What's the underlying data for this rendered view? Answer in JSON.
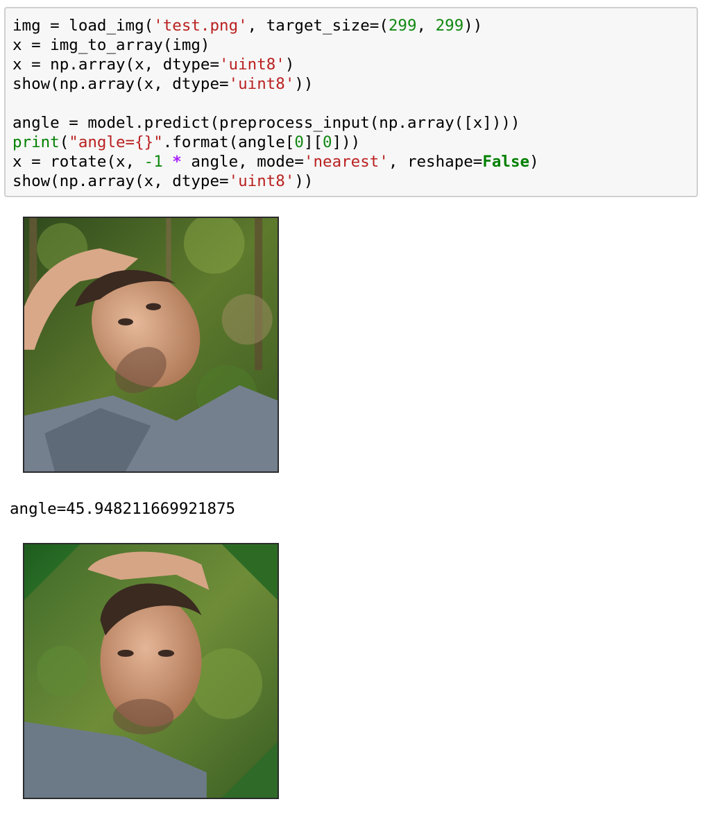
{
  "code_cell": {
    "lines": [
      [
        {
          "t": "img = load_img(",
          "c": ""
        },
        {
          "t": "'test.png'",
          "c": "str"
        },
        {
          "t": ", target_size=(",
          "c": ""
        },
        {
          "t": "299",
          "c": "num"
        },
        {
          "t": ", ",
          "c": ""
        },
        {
          "t": "299",
          "c": "num"
        },
        {
          "t": "))",
          "c": ""
        }
      ],
      [
        {
          "t": "x = img_to_array(img)",
          "c": ""
        }
      ],
      [
        {
          "t": "x = np.array(x, dtype=",
          "c": ""
        },
        {
          "t": "'uint8'",
          "c": "str"
        },
        {
          "t": ")",
          "c": ""
        }
      ],
      [
        {
          "t": "show(np.array(x, dtype=",
          "c": ""
        },
        {
          "t": "'uint8'",
          "c": "str"
        },
        {
          "t": "))",
          "c": ""
        }
      ],
      [],
      [
        {
          "t": "angle = model.predict(preprocess_input(np.array([x])))",
          "c": ""
        }
      ],
      [
        {
          "t": "print",
          "c": "builtin"
        },
        {
          "t": "(",
          "c": ""
        },
        {
          "t": "\"angle={}\"",
          "c": "str"
        },
        {
          "t": ".format(angle[",
          "c": ""
        },
        {
          "t": "0",
          "c": "num"
        },
        {
          "t": "][",
          "c": ""
        },
        {
          "t": "0",
          "c": "num"
        },
        {
          "t": "]))",
          "c": ""
        }
      ],
      [
        {
          "t": "x = rotate(x, ",
          "c": ""
        },
        {
          "t": "-1",
          "c": "num"
        },
        {
          "t": " ",
          "c": ""
        },
        {
          "t": "*",
          "c": "op"
        },
        {
          "t": " angle, mode=",
          "c": ""
        },
        {
          "t": "'nearest'",
          "c": "str"
        },
        {
          "t": ", reshape=",
          "c": ""
        },
        {
          "t": "False",
          "c": "kw"
        },
        {
          "t": ")",
          "c": ""
        }
      ],
      [
        {
          "t": "show(np.array(x, dtype=",
          "c": ""
        },
        {
          "t": "'uint8'",
          "c": "str"
        },
        {
          "t": "))",
          "c": ""
        }
      ]
    ]
  },
  "outputs": {
    "image_original": {
      "subject": "man-tilted-head-forest-photo"
    },
    "stdout_text": "angle=45.948211669921875",
    "image_rotated": {
      "subject": "man-upright-head-rotated-photo",
      "rotation_deg": -45.948211669921875
    }
  },
  "colors": {
    "string": "#ba2121",
    "number": "#118811",
    "builtin": "#008000",
    "keyword": "#008000",
    "operator": "#aa22ff",
    "cell_background": "#f7f7f7",
    "cell_border": "#cfcfcf"
  }
}
